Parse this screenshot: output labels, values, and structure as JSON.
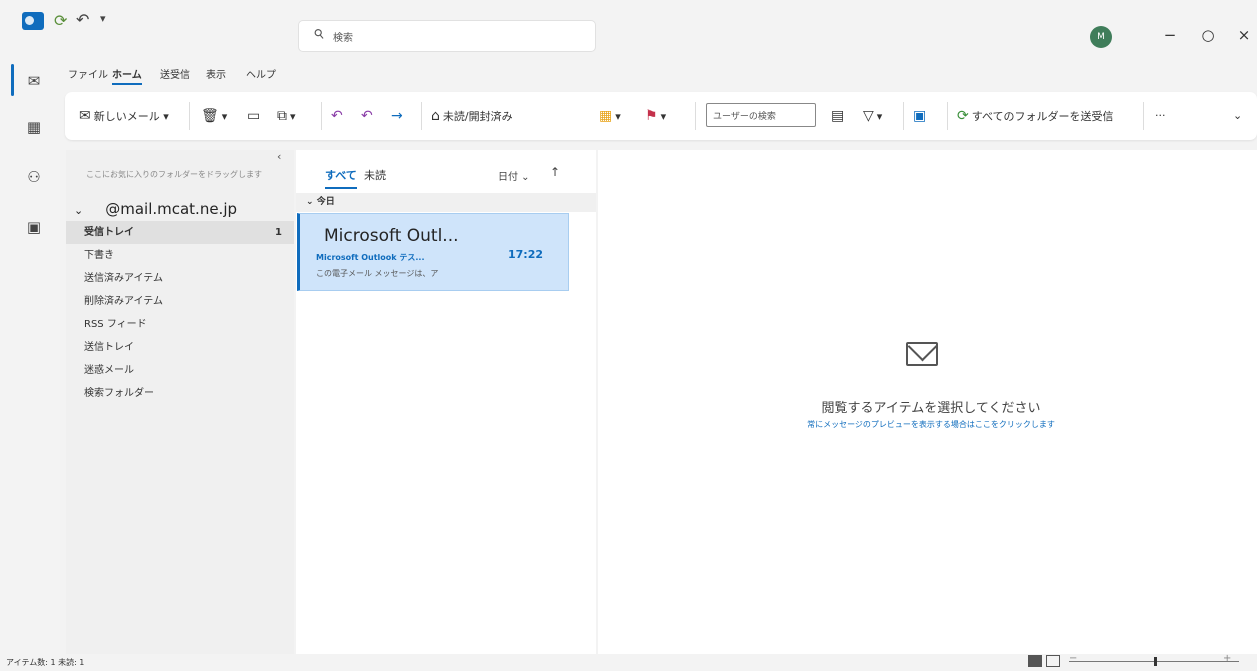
{
  "search": {
    "placeholder": "検索"
  },
  "titlebar": {
    "avatar_initial": "M",
    "minimize": "−",
    "restore": "○",
    "close": "×",
    "undo": "↶",
    "sync": "⟳",
    "qa_more": "▾"
  },
  "menu": {
    "tabs": [
      "ファイル",
      "ホーム",
      "送受信",
      "表示",
      "ヘルプ"
    ]
  },
  "ribbon": {
    "new_mail": "新しいメール",
    "unread_read": "未読/開封済み",
    "user_search": "ユーザーの検索",
    "send_receive_all": "すべてのフォルダーを送受信",
    "more": "···"
  },
  "folder_pane": {
    "drag_hint": "ここにお気に入りのフォルダーをドラッグします",
    "account": "@mail.mcat.ne.jp",
    "folders": [
      {
        "name": "受信トレイ",
        "count": "1"
      },
      {
        "name": "下書き"
      },
      {
        "name": "送信済みアイテム"
      },
      {
        "name": "削除済みアイテム"
      },
      {
        "name": "RSS フィード"
      },
      {
        "name": "送信トレイ"
      },
      {
        "name": "迷惑メール"
      },
      {
        "name": "検索フォルダー"
      }
    ]
  },
  "message_list": {
    "tab_all": "すべて",
    "tab_unread": "未読",
    "sort_by": "日付",
    "group": "今日",
    "messages": [
      {
        "from": "Microsoft Outl...",
        "subject": "Microsoft Outlook テス...",
        "time": "17:22",
        "preview": "この電子メール メッセージは、ア"
      }
    ]
  },
  "reading_pane": {
    "title": "閲覧するアイテムを選択してください",
    "subtitle": "常にメッセージのプレビューを表示する場合はここをクリックします"
  },
  "status": {
    "text": "アイテム数: 1   未読: 1"
  },
  "colors": {
    "accent": "#0f6cbd",
    "selected_item": "#cfe4fa"
  }
}
